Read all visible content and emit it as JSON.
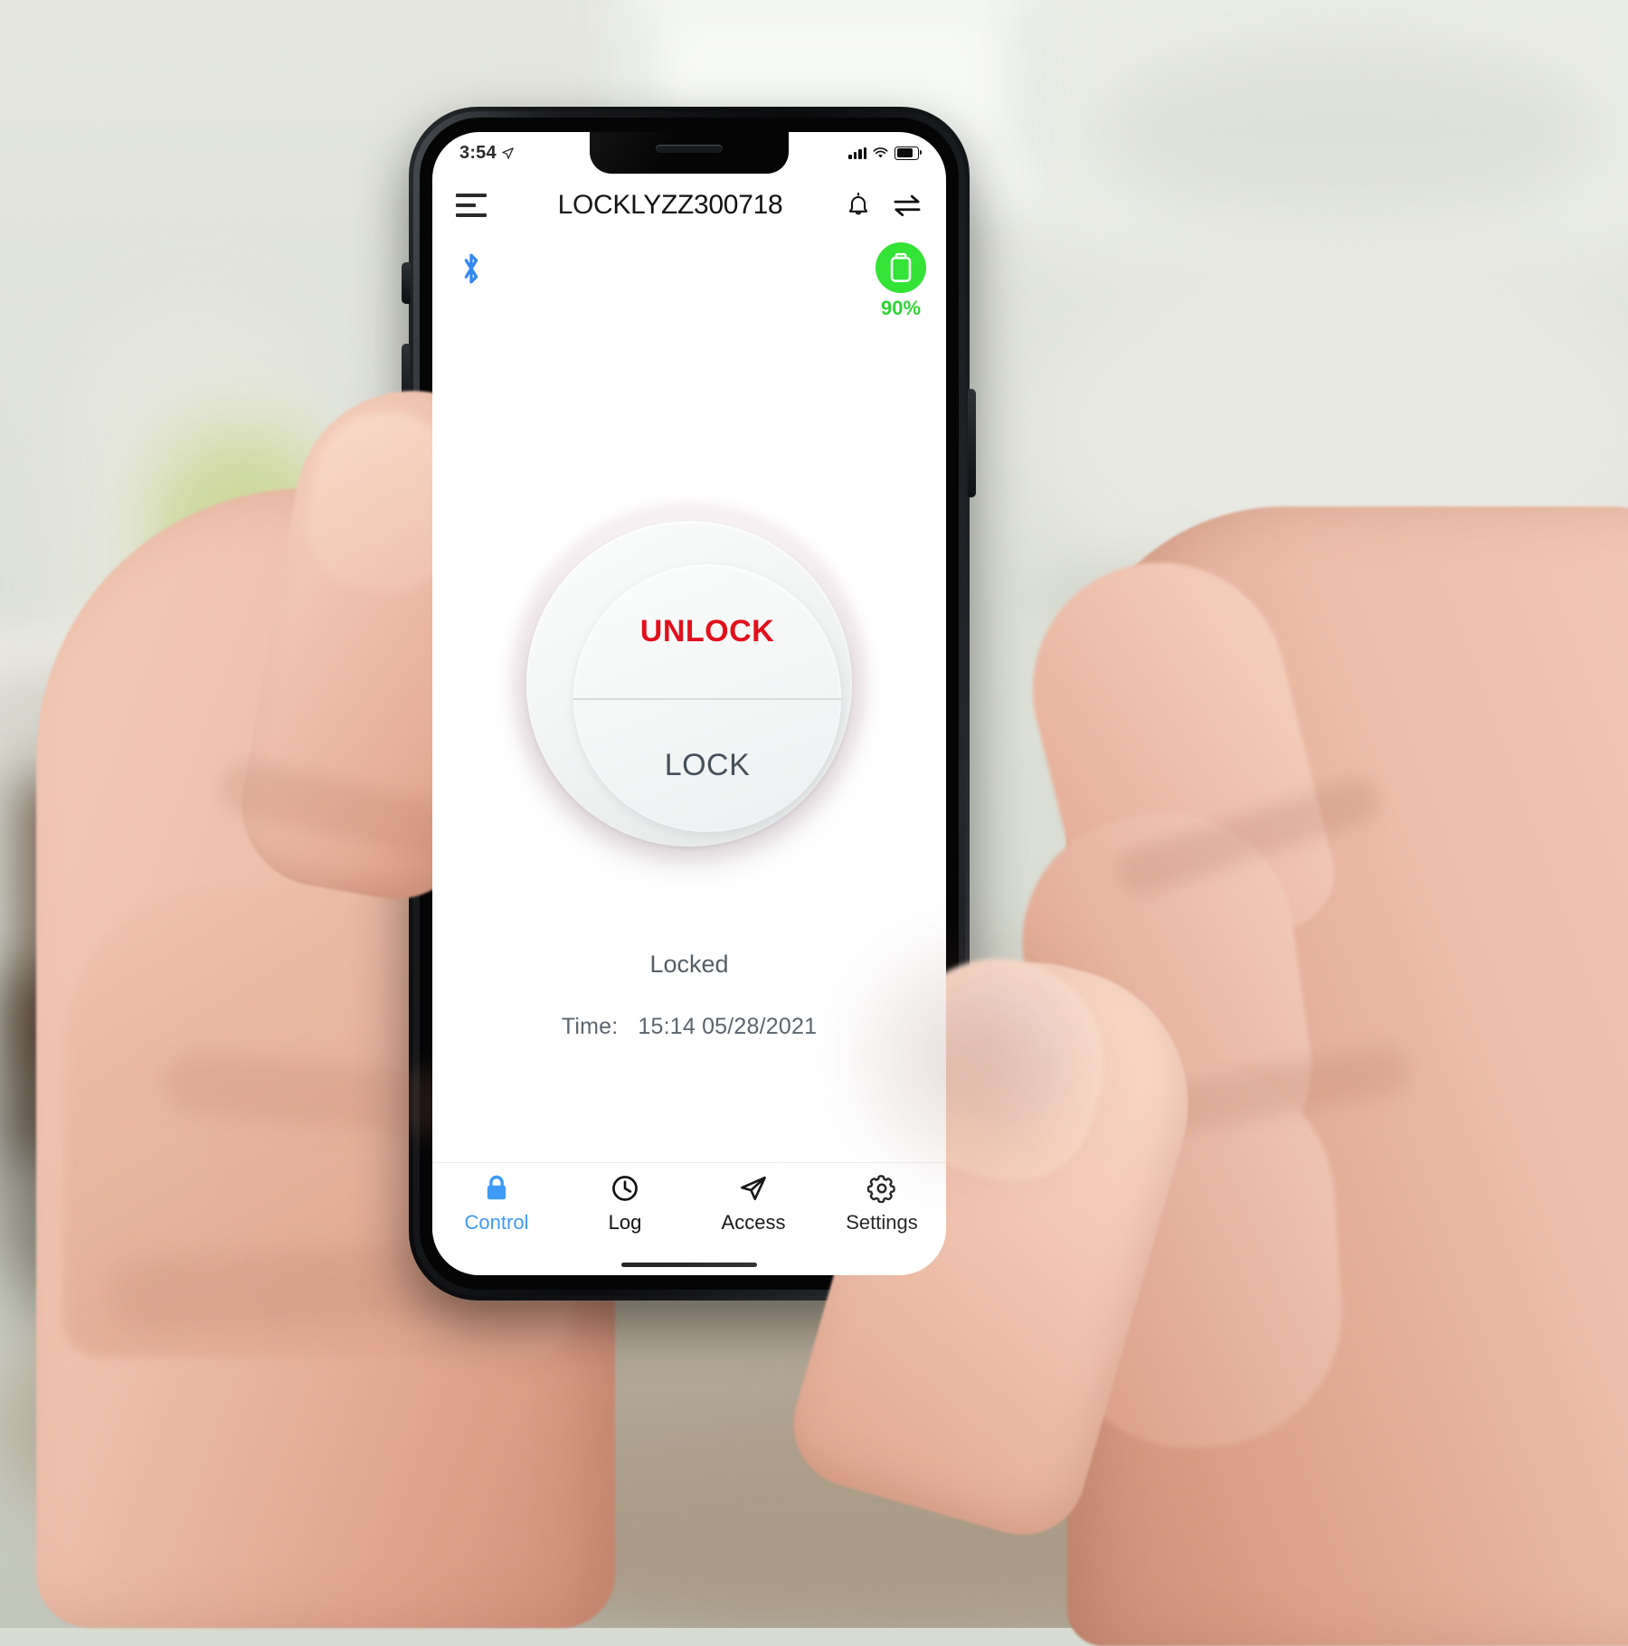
{
  "device": {
    "status_bar": {
      "time": "3:54",
      "location_icon": "location-arrow-icon",
      "signal_icon": "cellular-signal-icon",
      "wifi_icon": "wifi-icon",
      "battery_icon": "battery-icon"
    }
  },
  "app": {
    "header": {
      "menu_icon": "hamburger-menu-icon",
      "title": "LOCKLYZZ300718",
      "notification_icon": "bell-icon",
      "transfer_icon": "swap-arrows-icon"
    },
    "connection": {
      "bluetooth_icon": "bluetooth-icon",
      "bluetooth_color": "#1f7cf2",
      "battery_percent": "90%",
      "battery_color": "#33e336",
      "battery_icon": "battery-circle-icon"
    },
    "dial": {
      "unlock_label": "UNLOCK",
      "unlock_color": "#e2101b",
      "lock_label": "LOCK",
      "lock_color": "#46505a"
    },
    "status": {
      "state": "Locked",
      "time_label": "Time:",
      "time_value": "15:14  05/28/2021"
    },
    "tabs": [
      {
        "label": "Control",
        "icon": "lock-icon",
        "active": true,
        "color": "#3e9bf5"
      },
      {
        "label": "Log",
        "icon": "clock-icon",
        "active": false,
        "color": "#111111"
      },
      {
        "label": "Access",
        "icon": "paper-plane-icon",
        "active": false,
        "color": "#111111"
      },
      {
        "label": "Settings",
        "icon": "gear-icon",
        "active": false,
        "color": "#111111"
      }
    ]
  }
}
